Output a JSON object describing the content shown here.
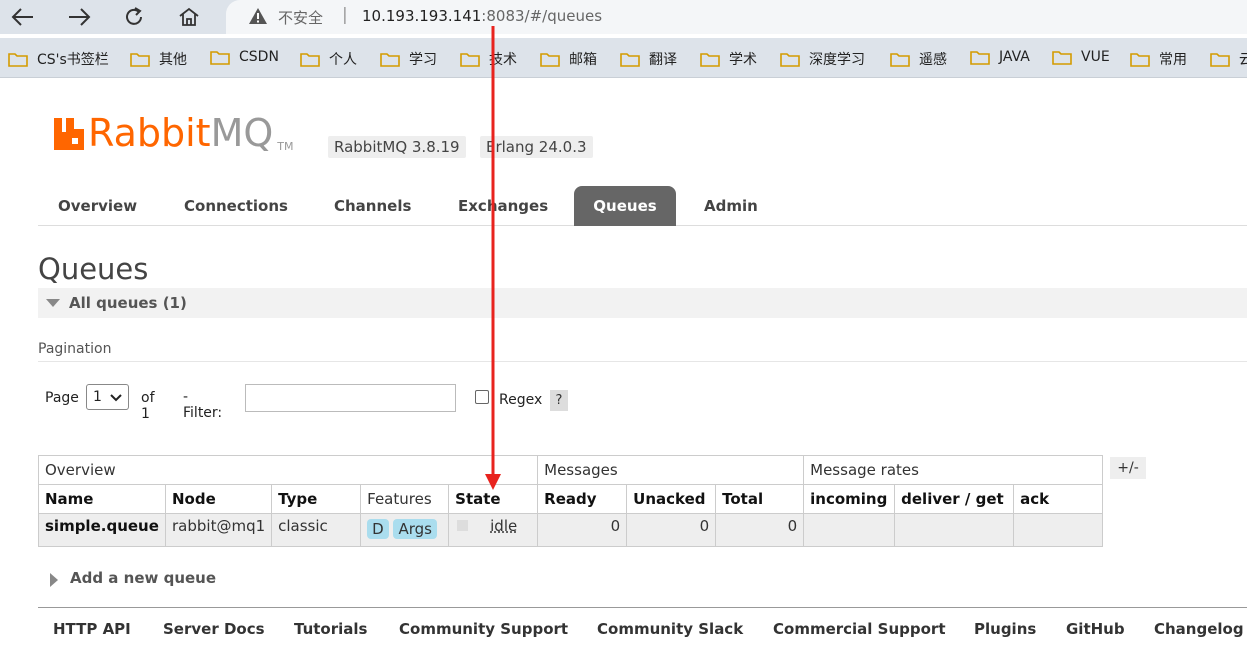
{
  "browser": {
    "insecure_label": "不安全",
    "url_host": "10.193.193.141",
    "url_rest": ":8083/#/queues"
  },
  "bookmarks": [
    "CS's书签栏",
    "其他",
    "CSDN",
    "个人",
    "学习",
    "技术",
    "邮箱",
    "翻译",
    "学术",
    "深度学习",
    "遥感",
    "JAVA",
    "VUE",
    "常用",
    "云"
  ],
  "header": {
    "logo_rabbit": "Rabbit",
    "logo_mq": "MQ",
    "logo_tm": "TM",
    "rabbitmq_version": "RabbitMQ 3.8.19",
    "erlang_version": "Erlang 24.0.3"
  },
  "tabs": [
    "Overview",
    "Connections",
    "Channels",
    "Exchanges",
    "Queues",
    "Admin"
  ],
  "active_tab": "Queues",
  "page_title": "Queues",
  "section_title": "All queues (1)",
  "pagination": {
    "label": "Pagination",
    "page_label": "Page",
    "page_value": "1",
    "of_label": "of 1",
    "filter_label": "- Filter:",
    "regex_label": "Regex",
    "help_label": "?"
  },
  "table": {
    "groups": [
      "Overview",
      "Messages",
      "Message rates"
    ],
    "columns": [
      "Name",
      "Node",
      "Type",
      "Features",
      "State",
      "Ready",
      "Unacked",
      "Total",
      "incoming",
      "deliver / get",
      "ack"
    ],
    "rows": [
      {
        "name": "simple.queue",
        "node": "rabbit@mq1",
        "type": "classic",
        "features": [
          "D",
          "Args"
        ],
        "state": "idle",
        "ready": "0",
        "unacked": "0",
        "total": "0",
        "incoming": "",
        "deliver_get": "",
        "ack": ""
      }
    ],
    "plus_minus": "+/-"
  },
  "add_queue_label": "Add a new queue",
  "footer_links": [
    "HTTP API",
    "Server Docs",
    "Tutorials",
    "Community Support",
    "Community Slack",
    "Commercial Support",
    "Plugins",
    "GitHub",
    "Changelog"
  ],
  "colors": {
    "brand": "#ff6600",
    "active_tab": "#666666",
    "badge": "#aaddee",
    "annotation_arrow": "#e8231e"
  }
}
